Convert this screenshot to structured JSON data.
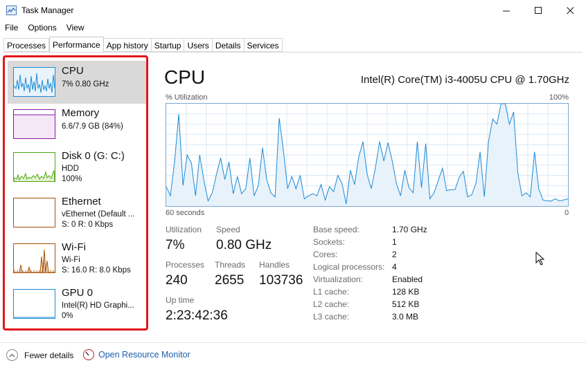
{
  "window": {
    "title": "Task Manager"
  },
  "menu": [
    "File",
    "Options",
    "View"
  ],
  "tabs": [
    "Processes",
    "Performance",
    "App history",
    "Startup",
    "Users",
    "Details",
    "Services"
  ],
  "sidebar": {
    "items": [
      {
        "name": "CPU",
        "sub1": "7%  0.80 GHz",
        "color": "#1a8ad4"
      },
      {
        "name": "Memory",
        "sub1": "6.6/7.9 GB (84%)",
        "color": "#8b12ae"
      },
      {
        "name": "Disk 0 (G: C:)",
        "sub1": "HDD",
        "sub2": "100%",
        "color": "#4da60c"
      },
      {
        "name": "Ethernet",
        "sub1": "vEthernet (Default ...",
        "sub2": "S: 0  R: 0 Kbps",
        "color": "#a74f01"
      },
      {
        "name": "Wi-Fi",
        "sub1": "Wi-Fi",
        "sub2": "S: 16.0  R: 8.0 Kbps",
        "color": "#a74f01"
      },
      {
        "name": "GPU 0",
        "sub1": "Intel(R) HD Graphi...",
        "sub2": "0%",
        "color": "#1a8ad4"
      }
    ]
  },
  "main": {
    "title": "CPU",
    "model": "Intel(R) Core(TM) i3-4005U CPU @ 1.70GHz",
    "graph": {
      "top_left": "% Utilization",
      "top_right": "100%",
      "bottom_left": "60 seconds",
      "bottom_right": "0",
      "values": [
        19,
        10,
        44,
        90,
        20,
        50,
        42,
        10,
        50,
        25,
        5,
        13,
        31,
        47,
        26,
        43,
        12,
        29,
        12,
        17,
        47,
        10,
        20,
        57,
        26,
        13,
        9,
        86,
        54,
        17,
        29,
        17,
        30,
        7,
        10,
        12,
        10,
        21,
        6,
        19,
        14,
        30,
        22,
        2,
        35,
        21,
        48,
        63,
        31,
        17,
        38,
        63,
        44,
        62,
        44,
        22,
        10,
        35,
        18,
        13,
        63,
        18,
        61,
        7,
        13,
        25,
        37,
        15,
        16,
        16,
        28,
        34,
        9,
        11,
        22,
        53,
        9,
        63,
        85,
        80,
        102,
        101,
        80,
        92,
        33,
        10,
        13,
        9,
        53,
        17,
        6,
        5,
        5,
        7,
        5,
        6,
        7
      ]
    },
    "stats": {
      "utilization_label": "Utilization",
      "utilization": "7%",
      "speed_label": "Speed",
      "speed": "0.80 GHz",
      "processes_label": "Processes",
      "processes": "240",
      "threads_label": "Threads",
      "threads": "2655",
      "handles_label": "Handles",
      "handles": "103736",
      "uptime_label": "Up time",
      "uptime": "2:23:42:36"
    },
    "specs": [
      {
        "label": "Base speed:",
        "value": "1.70 GHz"
      },
      {
        "label": "Sockets:",
        "value": "1"
      },
      {
        "label": "Cores:",
        "value": "2"
      },
      {
        "label": "Logical processors:",
        "value": "4"
      },
      {
        "label": "Virtualization:",
        "value": "Enabled"
      },
      {
        "label": "L1 cache:",
        "value": "128 KB"
      },
      {
        "label": "L2 cache:",
        "value": "512 KB"
      },
      {
        "label": "L3 cache:",
        "value": "3.0 MB"
      }
    ]
  },
  "footer": {
    "fewer_details": "Fewer details",
    "resource_monitor": "Open Resource Monitor"
  },
  "colors": {
    "accent": "#1a8ad4",
    "highlight": "#e3141b",
    "link": "#1b5fb0"
  }
}
